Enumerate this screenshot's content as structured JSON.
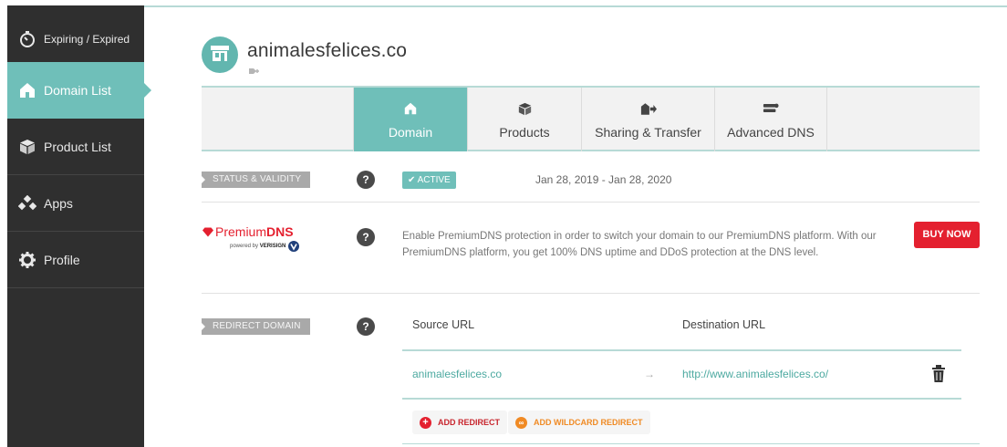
{
  "sidebar": {
    "items": [
      {
        "label": "Expiring / Expired",
        "icon": "stopwatch-icon"
      },
      {
        "label": "Domain List",
        "icon": "home-icon",
        "active": true
      },
      {
        "label": "Product List",
        "icon": "box-icon"
      },
      {
        "label": "Apps",
        "icon": "apps-icon"
      },
      {
        "label": "Profile",
        "icon": "gear-icon"
      }
    ]
  },
  "header": {
    "domain": "animalesfelices.co",
    "avatar_icon": "storefront-icon",
    "tag_icon": "tag-add-icon"
  },
  "tabs": [
    {
      "label": "Domain",
      "icon": "home-icon",
      "active": true
    },
    {
      "label": "Products",
      "icon": "box-icon"
    },
    {
      "label": "Sharing & Transfer",
      "icon": "share-transfer-icon"
    },
    {
      "label": "Advanced DNS",
      "icon": "dns-server-icon"
    }
  ],
  "status": {
    "label": "STATUS & VALIDITY",
    "badge": "✔ ACTIVE",
    "dates": "Jan 28, 2019 - Jan 28, 2020"
  },
  "premium_dns": {
    "logo_main": "Premium",
    "logo_bold": "DNS",
    "powered_by": "powered by",
    "verisign": "VERISIGN",
    "description": "Enable PremiumDNS protection in order to switch your domain to our PremiumDNS platform. With our PremiumDNS platform, you get 100% DNS uptime and DDoS protection at the DNS level.",
    "buy_label": "BUY NOW"
  },
  "redirect": {
    "label": "REDIRECT DOMAIN",
    "source_header": "Source URL",
    "dest_header": "Destination URL",
    "rows": [
      {
        "source": "animalesfelices.co",
        "arrow": "→",
        "destination": "http://www.animalesfelices.co/"
      }
    ],
    "add_redirect": "ADD REDIRECT",
    "add_wildcard": "ADD WILDCARD REDIRECT"
  },
  "help_glyph": "?",
  "colors": {
    "sidebar_bg": "#2f2f2f",
    "accent": "#6fbfb9",
    "buy_red": "#e4202f",
    "wildcard_orange": "#f08a24"
  }
}
